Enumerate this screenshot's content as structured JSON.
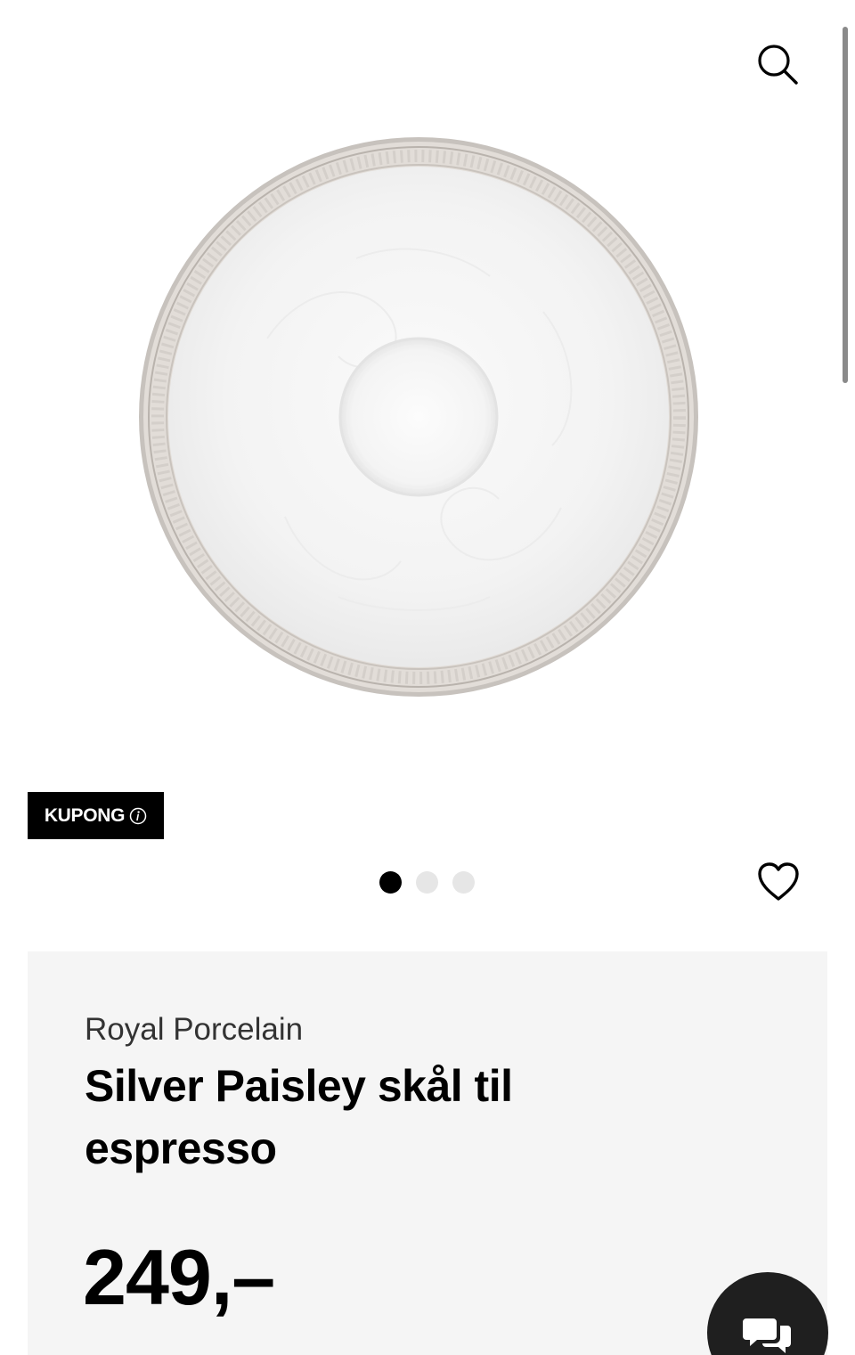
{
  "header": {
    "search_icon": "search-icon"
  },
  "product": {
    "image_alt": "Silver Paisley skål til espresso",
    "coupon_label": "KUPONG",
    "coupon_icon": "info-icon",
    "carousel": {
      "total": 3,
      "active_index": 0
    },
    "favorite_icon": "heart-icon",
    "brand": "Royal Porcelain",
    "title": "Silver Paisley skål til espresso",
    "price": "249,–"
  },
  "chat": {
    "icon": "chat-bubbles-icon"
  },
  "colors": {
    "badge_bg": "#000000",
    "card_bg": "#f5f5f5",
    "chat_bg": "#1f1f1f",
    "dot_active": "#000000",
    "dot_inactive": "#e6e6e6"
  }
}
